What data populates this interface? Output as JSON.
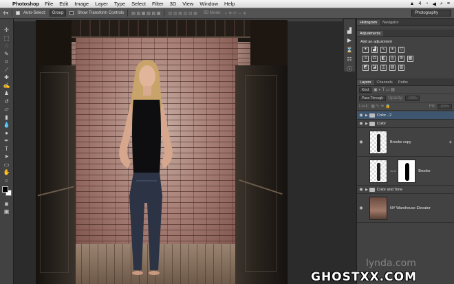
{
  "menubar": {
    "apple_glyph": "",
    "app_name": "Photoshop",
    "items": [
      "File",
      "Edit",
      "Image",
      "Layer",
      "Type",
      "Select",
      "Filter",
      "3D",
      "View",
      "Window",
      "Help"
    ],
    "status": "4"
  },
  "options_bar": {
    "auto_select_label": "Auto-Select:",
    "auto_select_value": "Group",
    "show_transform_label": "Show Transform Controls",
    "mode_3d_label": "3D Mode:",
    "workspace": "Photography"
  },
  "panels": {
    "top_tabs": [
      "Histogram",
      "Navigator"
    ],
    "adjustments_tab": "Adjustments",
    "adjustments_title": "Add an adjustment",
    "layer_tabs": [
      "Layers",
      "Channels",
      "Paths"
    ],
    "kind_filter": "Kind",
    "blend_mode": "Pass Through",
    "opacity_label": "Opacity:",
    "opacity_value": "100%",
    "lock_label": "Lock:",
    "fill_label": "Fill:",
    "fill_value": "100%"
  },
  "layers": [
    {
      "name": "Color - 2",
      "type": "group",
      "selected": true
    },
    {
      "name": "Color",
      "type": "group",
      "selected": false
    },
    {
      "name": "Brooke copy",
      "type": "pixel",
      "selected": false
    },
    {
      "name": "Brooke",
      "type": "masked",
      "selected": false
    },
    {
      "name": "Color and Tone",
      "type": "group",
      "selected": false
    },
    {
      "name": "NY Warehouse Elevator",
      "type": "image",
      "selected": false
    }
  ],
  "watermarks": {
    "lynda": "lynda.com",
    "site": "GHOSTXX.COM"
  },
  "colors": {
    "selected_layer": "#3f5670",
    "panel_bg": "#424242",
    "accent_blue": "#4a6a96"
  }
}
